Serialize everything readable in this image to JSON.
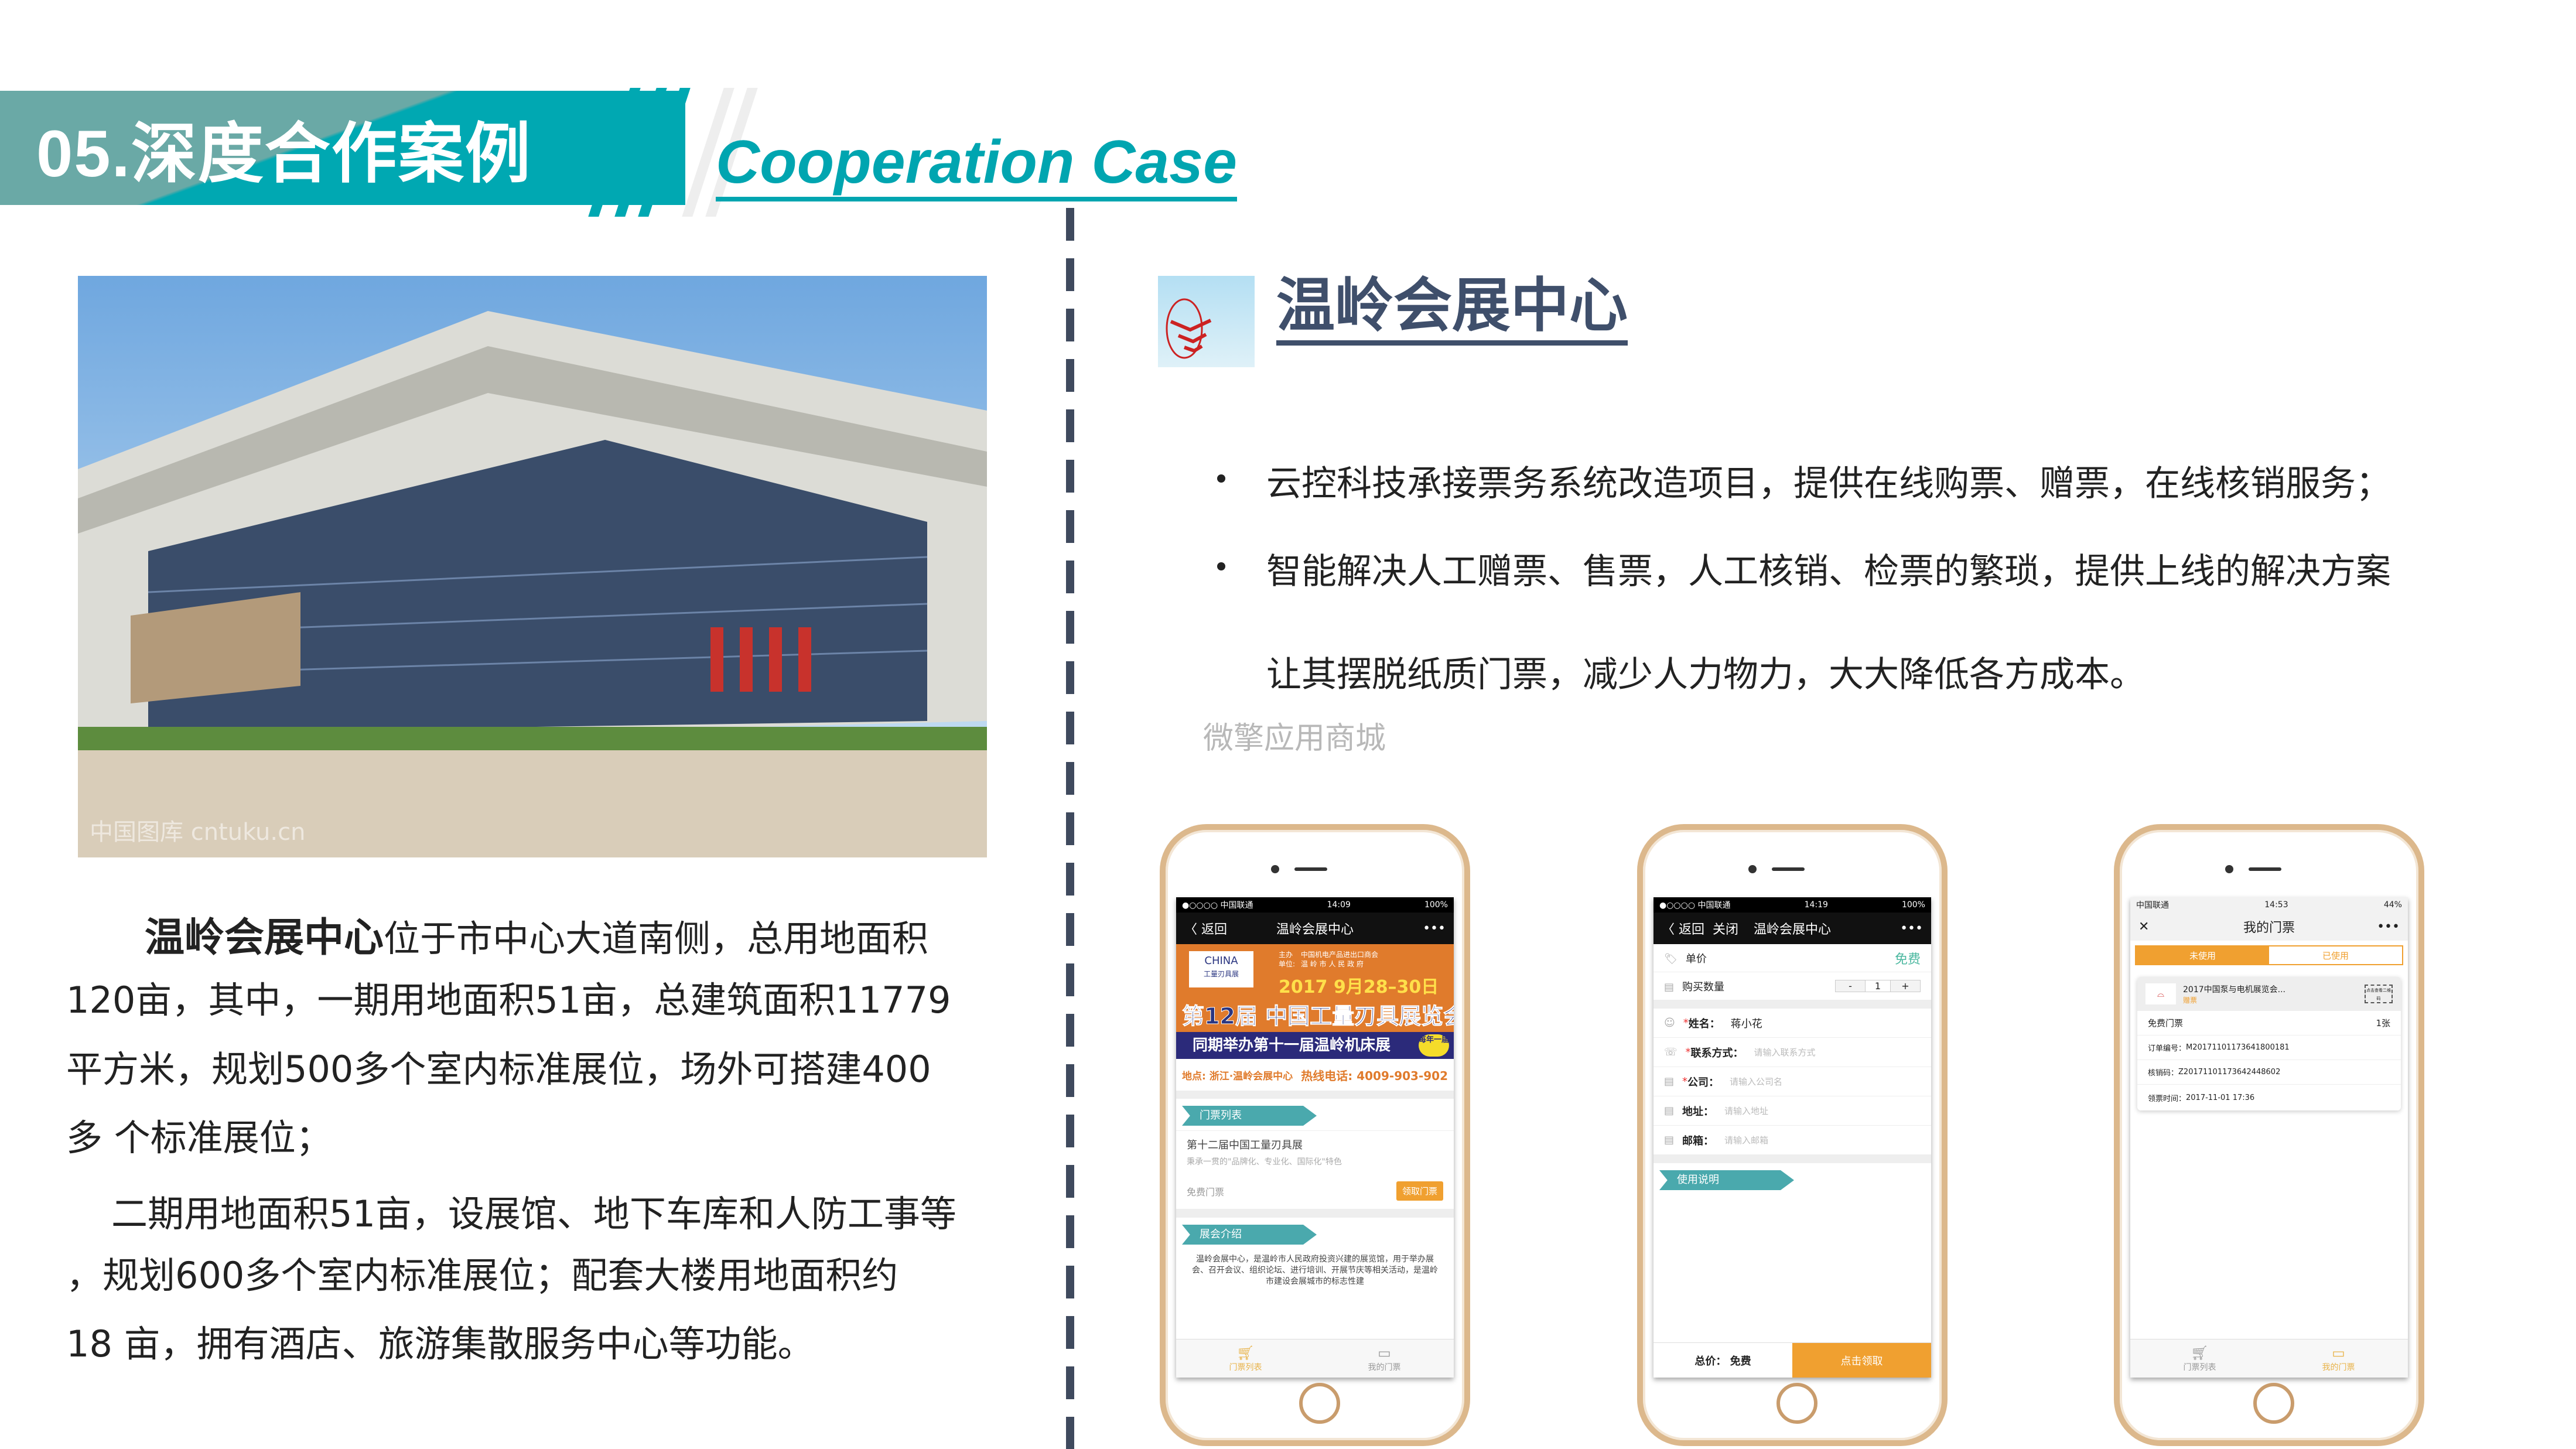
{
  "header": {
    "section_title": "05.深度合作案例",
    "subtitle_en": "Cooperation Case",
    "accent": "#00a8b2"
  },
  "photo": {
    "watermark": "中国图库 cntuku.cn"
  },
  "left_text": {
    "bold_name": "温岭会展中心",
    "lines": [
      "位于市中心大道南侧，总用地面积",
      "120亩，其中，一期用地面积51亩，总建筑面积11779",
      "平方米，规划500多个室内标准展位，场外可搭建400",
      "多 个标准展位；",
      "二期用地面积51亩，设展馆、地下车库和人防工事等",
      "，规划600多个室内标准展位；配套大楼用地面积约",
      "18 亩，拥有酒店、旅游集散服务中心等功能。"
    ]
  },
  "case": {
    "title": "温岭会展中心",
    "logo_icon": "wenling-logo",
    "bullets": [
      "云控科技承接票务系统改造项目，提供在线购票、赠票，在线核销服务；",
      "智能解决人工赠票、售票，人工核销、检票的繁琐，提供上线的解决方案"
    ],
    "continuation": "让其摆脱纸质门票，减少人力物力，大大降低各方成本。",
    "watermark": "微擎应用商城"
  },
  "phone1": {
    "status": {
      "carrier": "●○○○○ 中国联通",
      "time": "14:09",
      "battery": "100%"
    },
    "nav": {
      "back": "〈 返回",
      "title": "温岭会展中心",
      "more": "•••"
    },
    "banner": {
      "logo_text": "CHINA",
      "logo_sub": "工量刃具展",
      "organizer_label": "主办单位:",
      "organizers": [
        "中国机电产品进出口商会",
        "温 岭 市 人 民 政 府"
      ],
      "date": "2017 9月28–30日",
      "headline": "第12届 中国工量刃具展览会",
      "strip": "同期举办第十一届温岭机床展",
      "badge": "每年一届",
      "venue": "地点: 浙江·温岭会展中心",
      "hotline": "热线电话: 4009-903-902"
    },
    "section1": "门票列表",
    "item_title": "第十二届中国工量刃具展",
    "item_sub": "秉承一贯的\"品牌化、专业化、国际化\"特色",
    "ticket_label": "免费门票",
    "get_button": "领取门票",
    "section2": "展会介绍",
    "intro": "温岭会展中心，是温岭市人民政府投资兴建的展览馆，用于举办展会、召开会议、组织论坛、进行培训、开展节庆等相关活动，是温岭市建设会展城市的标志性建",
    "tabs": [
      "门票列表",
      "我的门票"
    ],
    "accent": "#f0a030"
  },
  "phone2": {
    "status": {
      "carrier": "●○○○○ 中国联通",
      "time": "14:19",
      "battery": "100%"
    },
    "nav": {
      "back": "〈 返回",
      "close": "关闭",
      "title": "温岭会展中心",
      "more": "•••"
    },
    "price_label": "单价",
    "price_value": "免费",
    "qty_label": "购买数量",
    "qty_minus": "-",
    "qty_value": "1",
    "qty_plus": "+",
    "fields": [
      {
        "label": "姓名：",
        "value": "蒋小花",
        "required": true
      },
      {
        "label": "联系方式：",
        "placeholder": "请输入联系方式",
        "required": true
      },
      {
        "label": "公司：",
        "placeholder": "请输入公司名",
        "required": true
      },
      {
        "label": "地址：",
        "placeholder": "请输入地址",
        "required": false
      },
      {
        "label": "邮箱：",
        "placeholder": "请输入邮箱",
        "required": false
      }
    ],
    "required_mark": "*",
    "section": "使用说明",
    "total": "总价： 免费",
    "submit": "点击领取"
  },
  "phone3": {
    "status": {
      "carrier": "中国联通",
      "time": "14:53",
      "battery": "44%"
    },
    "nav": {
      "close": "✕",
      "title": "我的门票",
      "more": "•••"
    },
    "seg": [
      "未使用",
      "已使用"
    ],
    "ticket": {
      "name": "2017中国泵与电机展览会...",
      "type": "赠票",
      "qr": "点击查看二维码",
      "kind": "免费门票",
      "count": "1张",
      "order_label": "订单编号：",
      "order": "M20171101173641800181",
      "code_label": "核销码：",
      "code": "Z20171101173642448602",
      "time_label": "领票时间：",
      "time": "2017-11-01 17:36"
    },
    "tabs": [
      "门票列表",
      "我的门票"
    ]
  }
}
